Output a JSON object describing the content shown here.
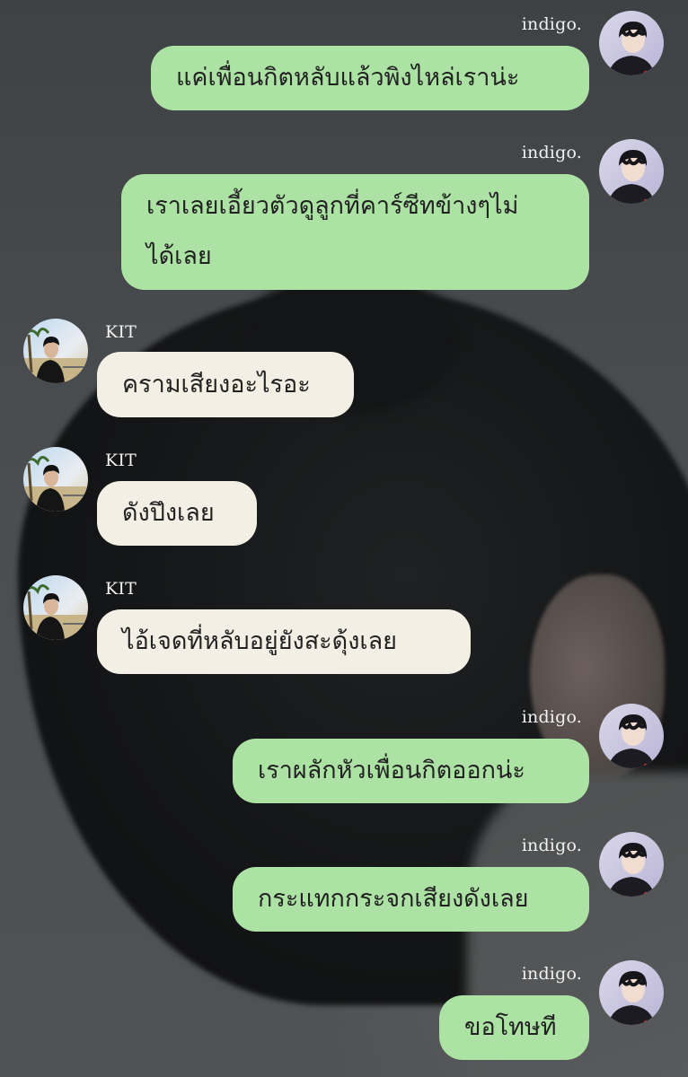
{
  "chat": {
    "messages": [
      {
        "sender": "indigo.",
        "side": "right",
        "text": "แค่เพื่อนกิตหลับแล้วพิงไหล่เราน่ะ"
      },
      {
        "sender": "indigo.",
        "side": "right",
        "lines": [
          "เราเลยเอี้ยวตัวดูลูกที่คาร์ซีทข้างๆไม่",
          "ได้เลย"
        ]
      },
      {
        "sender": "KIT",
        "side": "left",
        "text": "ครามเสียงอะไรอะ"
      },
      {
        "sender": "KIT",
        "side": "left",
        "text": "ดังปึงเลย"
      },
      {
        "sender": "KIT",
        "side": "left",
        "text": "ไอ้เจดที่หลับอยู่ยังสะดุ้งเลย"
      },
      {
        "sender": "indigo.",
        "side": "right",
        "text": "เราผลักหัวเพื่อนกิตออกน่ะ"
      },
      {
        "sender": "indigo.",
        "side": "right",
        "text": "กระแทกกระจกเสียงดังเลย"
      },
      {
        "sender": "indigo.",
        "side": "right",
        "text": "ขอโทษที"
      }
    ]
  },
  "colors": {
    "right_bubble": "#ace3a4",
    "left_bubble": "#f4efe4",
    "name_text": "#f1f1f1"
  }
}
